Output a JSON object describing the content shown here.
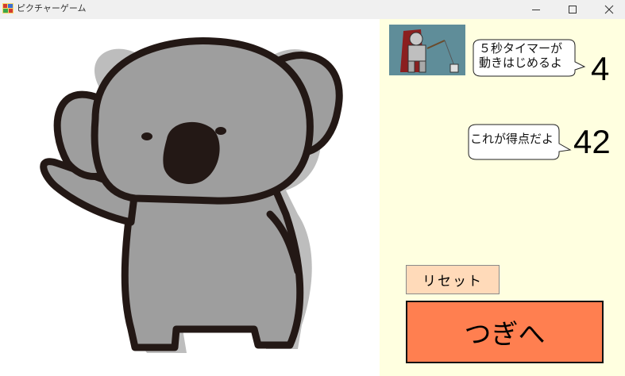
{
  "window": {
    "title": "ピクチャーゲーム",
    "controls": [
      "minimize",
      "maximize",
      "close"
    ]
  },
  "picture": {
    "subject": "koala",
    "colors": {
      "body": "#9e9e9e",
      "shadow": "#bdbdbd",
      "outline": "#231815"
    }
  },
  "timer_panel": {
    "bubble_text": "５秒タイマーが\n動きはじめるよ",
    "value": "4"
  },
  "score_panel": {
    "bubble_text": "これが得点だよ",
    "value": "42"
  },
  "buttons": {
    "reset_label": "リセット",
    "next_label": "つぎへ"
  },
  "colors": {
    "side_panel_bg": "#ffffe0",
    "reset_bg": "#ffdab9",
    "next_bg": "#ff7f50"
  }
}
